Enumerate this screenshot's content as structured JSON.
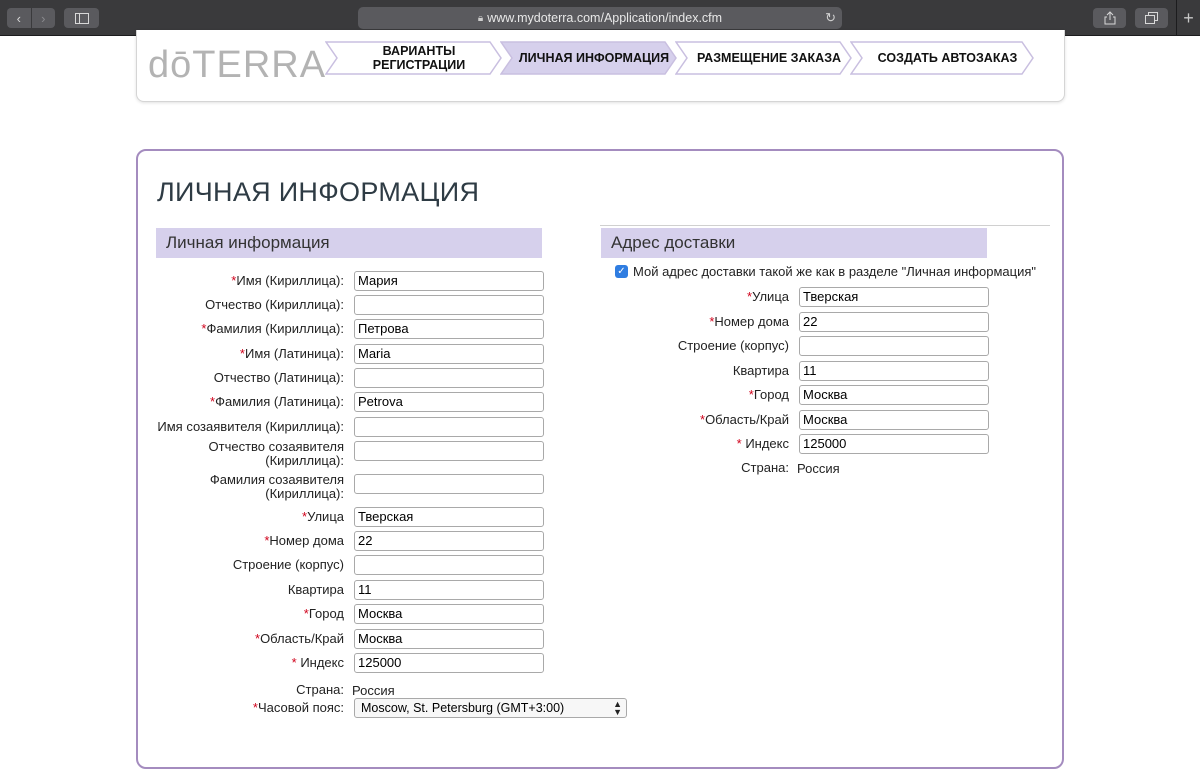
{
  "browser": {
    "url": "www.mydoterra.com/Application/index.cfm"
  },
  "logo": "dōTERRA",
  "steps": [
    {
      "label_line1": "ВАРИАНТЫ",
      "label_line2": "РЕГИСТРАЦИИ",
      "active": false
    },
    {
      "label_line1": "ЛИЧНАЯ ИНФОРМАЦИЯ",
      "label_line2": "",
      "active": true
    },
    {
      "label_line1": "РАЗМЕЩЕНИЕ ЗАКАЗА",
      "label_line2": "",
      "active": false
    },
    {
      "label_line1": "СОЗДАТЬ АВТОЗАКАЗ",
      "label_line2": "",
      "active": false
    }
  ],
  "page_title": "ЛИЧНАЯ ИНФОРМАЦИЯ",
  "personal": {
    "heading": "Личная информация",
    "fields": [
      {
        "label": "Имя (Кириллица):",
        "required": true,
        "value": "Мария"
      },
      {
        "label": "Отчество (Кириллица):",
        "required": false,
        "value": ""
      },
      {
        "label": "Фамилия (Кириллица):",
        "required": true,
        "value": "Петрова"
      },
      {
        "label": "Имя (Латиница):",
        "required": true,
        "value": "Maria"
      },
      {
        "label": "Отчество (Латиница):",
        "required": false,
        "value": ""
      },
      {
        "label": "Фамилия (Латиница):",
        "required": true,
        "value": "Petrova"
      },
      {
        "label": "Имя созаявителя (Кириллица):",
        "required": false,
        "value": ""
      },
      {
        "label": "Отчество созаявителя (Кириллица):",
        "required": false,
        "value": ""
      },
      {
        "label": "Фамилия созаявителя (Кириллица):",
        "required": false,
        "value": ""
      },
      {
        "label": "Улица",
        "required": true,
        "value": "Тверская"
      },
      {
        "label": "Номер дома",
        "required": true,
        "value": "22"
      },
      {
        "label": "Строение (корпус)",
        "required": false,
        "value": ""
      },
      {
        "label": "Квартира",
        "required": false,
        "value": "11"
      },
      {
        "label": "Город",
        "required": true,
        "value": "Москва"
      },
      {
        "label": "Область/Край",
        "required": true,
        "value": "Москва"
      },
      {
        "label": " Индекс",
        "required": true,
        "value": "125000"
      }
    ],
    "country_label": "Страна:",
    "country_value": "Россия",
    "timezone_label": "Часовой пояс:",
    "timezone_value": "Moscow, St. Petersburg (GMT+3:00)"
  },
  "shipping": {
    "heading": "Адрес доставки",
    "same_checkbox_label": "Мой адрес доставки такой же как в разделе \"Личная информация\"",
    "same_checked": true,
    "fields": [
      {
        "label": "Улица",
        "required": true,
        "value": "Тверская"
      },
      {
        "label": "Номер дома",
        "required": true,
        "value": "22"
      },
      {
        "label": "Строение (корпус)",
        "required": false,
        "value": ""
      },
      {
        "label": "Квартира",
        "required": false,
        "value": "11"
      },
      {
        "label": "Город",
        "required": true,
        "value": "Москва"
      },
      {
        "label": "Область/Край",
        "required": true,
        "value": "Москва"
      },
      {
        "label": " Индекс",
        "required": true,
        "value": "125000"
      }
    ],
    "country_label": "Страна:",
    "country_value": "Россия"
  },
  "colors": {
    "accent_purple": "#a48cbf",
    "section_header_bg": "#d6d0ec",
    "required_red": "#d0021b"
  }
}
